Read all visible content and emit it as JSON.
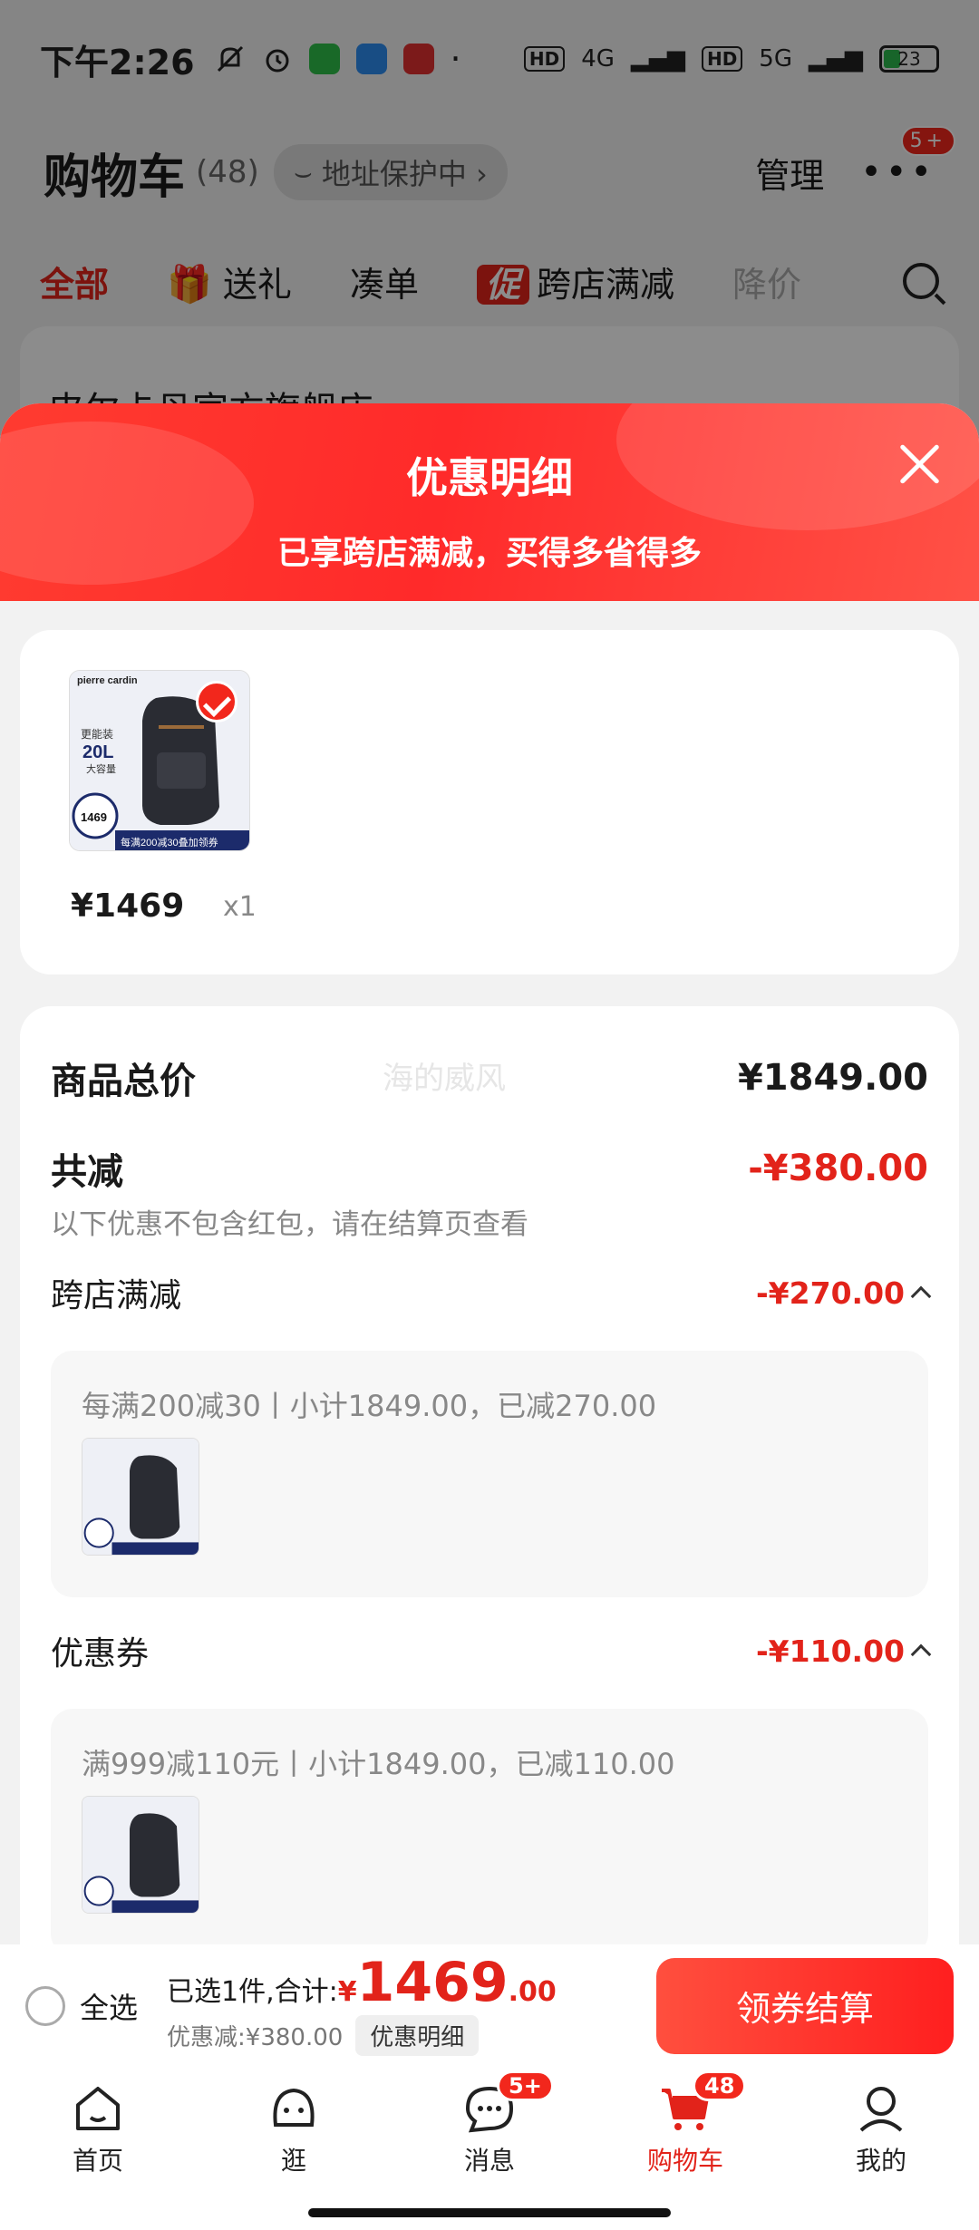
{
  "status_bar": {
    "time": "下午2:26",
    "net1": "4G",
    "net2": "5G",
    "battery": "23",
    "icons": [
      "mute-icon",
      "alarm-icon",
      "wechat-icon",
      "message-app-icon",
      "red-app-icon"
    ]
  },
  "cart": {
    "title": "购物车",
    "count": "(48)",
    "address_protect": "地址保护中 ›",
    "manage": "管理",
    "more_badge": "5+",
    "tabs": [
      "全部",
      "送礼",
      "凑单",
      "跨店满减",
      "降价"
    ],
    "promo_tag": "促",
    "store_name": "皮尔卡丹官方旗舰店 ›"
  },
  "sheet": {
    "title": "优惠明细",
    "subtitle": "已享跨店满减，买得多省得多",
    "product": {
      "brand": "pierre cardin",
      "img_line1": "更能装",
      "img_line2": "20L",
      "img_line3": "大容量",
      "img_price": "1469",
      "img_promo": "每满200减30叠加领券",
      "price": "¥1469",
      "qty": "x1"
    },
    "watermark": "海的威风",
    "total_label": "商品总价",
    "total_value": "¥1849.00",
    "discount_label": "共减",
    "discount_value": "-¥380.00",
    "note": "以下优惠不包含红包，请在结算页查看",
    "cross_store": {
      "label": "跨店满减",
      "value": "-¥270.00",
      "detail": "每满200减30丨小计1849.00，已减270.00"
    },
    "coupon": {
      "label": "优惠券",
      "value": "-¥110.00",
      "detail": "满999减110元丨小计1849.00，已减110.00"
    }
  },
  "checkout": {
    "select_all": "全选",
    "selected_text": "已选1件,合计:",
    "currency": "¥",
    "total_int": "1469",
    "total_dec": ".00",
    "discount_text": "优惠减:¥380.00",
    "detail_button": "优惠明细",
    "pay_button": "领券结算"
  },
  "tabbar": {
    "items": [
      {
        "label": "首页",
        "icon": "home-icon"
      },
      {
        "label": "逛",
        "icon": "browse-icon"
      },
      {
        "label": "消息",
        "icon": "message-icon",
        "badge": "5+"
      },
      {
        "label": "购物车",
        "icon": "cart-icon",
        "badge": "48"
      },
      {
        "label": "我的",
        "icon": "profile-icon"
      }
    ]
  },
  "colors": {
    "accent": "#e2231a",
    "sheet_header": "#ff2a2a",
    "background": "#f2f2f2"
  }
}
